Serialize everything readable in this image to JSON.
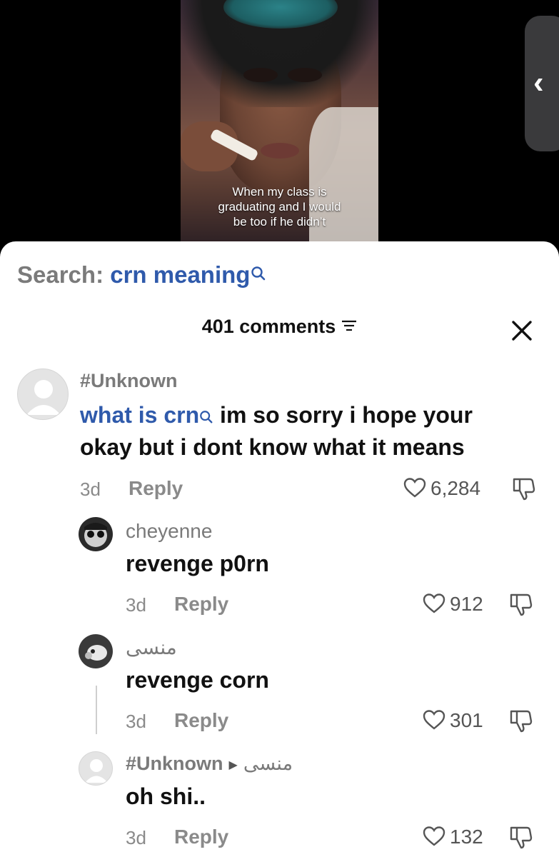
{
  "video": {
    "caption_lines": [
      "When my class is",
      "graduating and I would",
      "be too if he didn’t"
    ]
  },
  "search": {
    "prefix": "Search: ",
    "term": "crn meaning"
  },
  "header": {
    "count_label": "401 comments"
  },
  "comments": [
    {
      "username": "#Unknown",
      "link_text": "what is crn",
      "text_line1_rest": " im so sorry i hope your",
      "text_line2": "okay but i dont know what it means",
      "time": "3d",
      "reply_label": "Reply",
      "likes": "6,284"
    },
    {
      "username": "cheyenne",
      "text": "revenge p0rn",
      "time": "3d",
      "reply_label": "Reply",
      "likes": "912"
    },
    {
      "username": "منسى",
      "text": "revenge corn",
      "time": "3d",
      "reply_label": "Reply",
      "likes": "301"
    },
    {
      "username": "#Unknown",
      "reply_to": "منسى",
      "text": "oh shi..",
      "time": "3d",
      "reply_label": "Reply",
      "likes": "132"
    }
  ],
  "colors": {
    "link": "#2f5aab",
    "muted": "#8a8a8a",
    "sheet": "#ffffff"
  }
}
